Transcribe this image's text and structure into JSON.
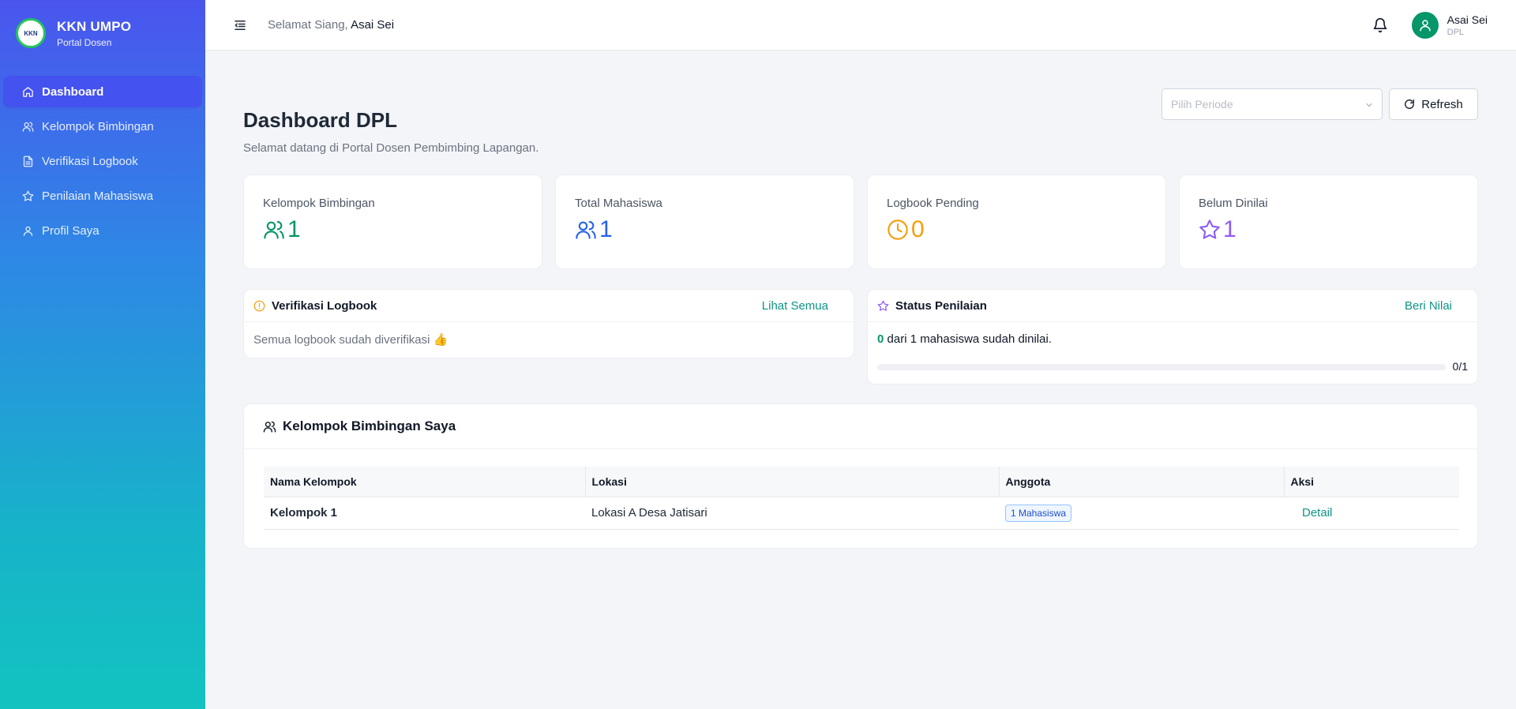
{
  "brand": {
    "title": "KKN UMPO",
    "subtitle": "Portal Dosen",
    "logo_text": "KKN"
  },
  "sidebar": {
    "items": [
      {
        "label": "Dashboard",
        "icon": "home-icon",
        "active": true
      },
      {
        "label": "Kelompok Bimbingan",
        "icon": "users-icon"
      },
      {
        "label": "Verifikasi Logbook",
        "icon": "file-icon"
      },
      {
        "label": "Penilaian Mahasiswa",
        "icon": "star-icon"
      },
      {
        "label": "Profil Saya",
        "icon": "user-icon"
      }
    ]
  },
  "topbar": {
    "greeting": "Selamat Siang,",
    "user_name": "Asai Sei",
    "user_role": "DPL"
  },
  "header": {
    "title": "Dashboard DPL",
    "subtitle": "Selamat datang di Portal Dosen Pembimbing Lapangan.",
    "period_placeholder": "Pilih Periode",
    "refresh_label": "Refresh"
  },
  "stats": [
    {
      "label": "Kelompok Bimbingan",
      "value": "1",
      "color": "#059669",
      "icon": "users-icon"
    },
    {
      "label": "Total Mahasiswa",
      "value": "1",
      "color": "#2563eb",
      "icon": "users-icon"
    },
    {
      "label": "Logbook Pending",
      "value": "0",
      "color": "#f59e0b",
      "icon": "clock-icon"
    },
    {
      "label": "Belum Dinilai",
      "value": "1",
      "color": "#8b5cf6",
      "icon": "star-icon"
    }
  ],
  "logbook_panel": {
    "title": "Verifikasi Logbook",
    "link": "Lihat Semua",
    "message": "Semua logbook sudah diverifikasi 👍"
  },
  "rating_panel": {
    "title": "Status Penilaian",
    "link": "Beri Nilai",
    "count": "0",
    "text_mid": " dari ",
    "total": "1",
    "text_end": " mahasiswa sudah dinilai.",
    "progress": 0,
    "progress_label": "0/1"
  },
  "groups_panel": {
    "title": "Kelompok Bimbingan Saya",
    "columns": [
      "Nama Kelompok",
      "Lokasi",
      "Anggota",
      "Aksi"
    ],
    "rows": [
      {
        "name": "Kelompok 1",
        "location": "Lokasi A Desa Jatisari",
        "members": "1 Mahasiswa",
        "action": "Detail"
      }
    ]
  }
}
